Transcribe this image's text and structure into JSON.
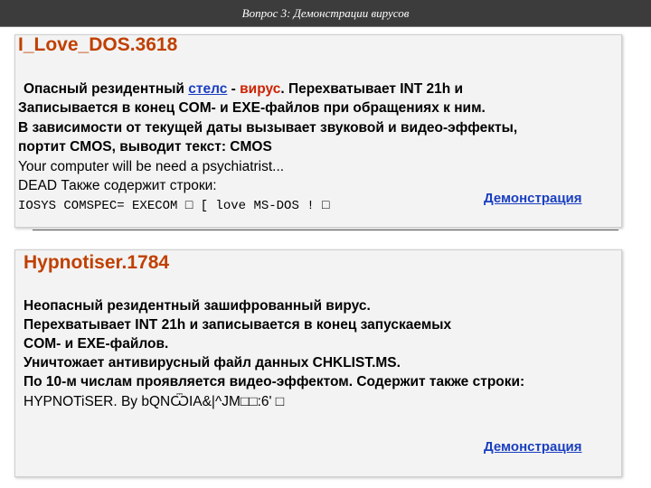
{
  "header": {
    "title": "Вопрос 3: Демонстрации вирусов"
  },
  "section1": {
    "heading": "I_Love_DOS.3618",
    "line1": {
      "prefix": "Опасный резидентный ",
      "stels": "стелс",
      "dash": " - ",
      "virus": "вирус",
      "rest": ". Перехватывает INT 21h и"
    },
    "line2": "Записывается в конец COM- и EXE-файлов при обращениях к ним.",
    "line3": "В зависимости от текущей даты вызывает звуковой и видео-эффекты,",
    "line4": "портит CMOS, выводит текст: CMOS",
    "line5": "Your computer will be need a psychiatrist...",
    "line6": "DEAD Также содержит строки:",
    "line7": "IOSYS COMSPEC= EXECOM □ [  love MS-DOS ! □",
    "demo_label": "Демонстрация"
  },
  "section2": {
    "heading": "Hypnotiser.1784",
    "line1": "Неопасный резидентный зашифрованный вирус.",
    "line2": "Перехватывает INT 21h и записывается в конец запускаемых",
    "line3": "COM- и EXE-файлов.",
    "line4": "Уничтожает антивирусный файл данных CHKLIST.MS.",
    "line5": "По 10-м числам проявляется видео-эффектом. Содержит также строки:",
    "line6": "HYPNOTiSER. By bQNѾIA&|^JM□□:6' □",
    "demo_label": "Демонстрация"
  },
  "colors": {
    "heading": "#c04000",
    "link": "#1a3fc0",
    "accent_red": "#cc2200",
    "header_bg": "#3c3c3c"
  }
}
